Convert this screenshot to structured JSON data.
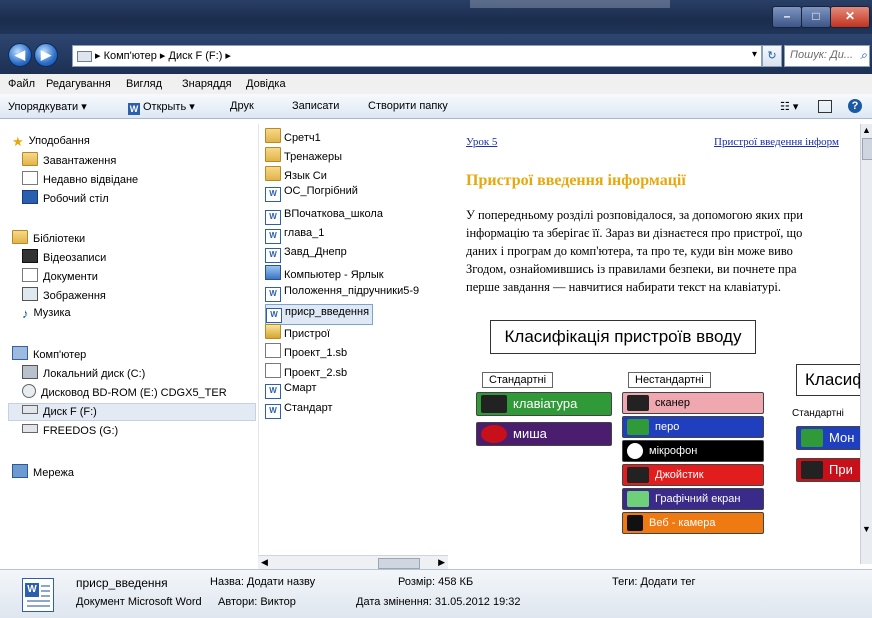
{
  "window": {
    "min_glyph": "–",
    "max_glyph": "□",
    "close_glyph": "✕"
  },
  "address": {
    "crumbs": "▸ Комп'ютер ▸ Диск F (F:) ▸",
    "search_placeholder": "Пошук: Ди..."
  },
  "menu": [
    "Файл",
    "Редагування",
    "Вигляд",
    "Знаряддя",
    "Довідка"
  ],
  "toolbar": {
    "organize": "Упорядкувати ▾",
    "open": "Открыть ▾",
    "print": "Друк",
    "burn": "Записати",
    "new_folder": "Створити папку"
  },
  "nav": {
    "favorites": "Уподобання",
    "downloads": "Завантаження",
    "recent": "Недавно відвідане",
    "desktop": "Робочий стіл",
    "libraries": "Бібліотеки",
    "videos": "Відеозаписи",
    "documents": "Документи",
    "pictures": "Зображення",
    "music": "Музика",
    "computer": "Комп'ютер",
    "local_c": "Локальний диск (C:)",
    "bd_rom": "Дисковод BD-ROM (E:) CDGX5_TER",
    "disk_f": "Диск F (F:)",
    "freedos": "FREEDOS (G:)",
    "network": "Мережа"
  },
  "files": [
    "Сретч1",
    "Тренажеры",
    "Язык Си",
    "ОС_Погрібний",
    "ВПочаткова_школа",
    "глава_1",
    "Завд_Днепр",
    "Компьютер - Ярлык",
    "Положення_підручники5-9",
    "присp_введення",
    "Пристрої",
    "Проект_1.sb",
    "Проект_2.sb",
    "Смарт",
    "Стандарт"
  ],
  "preview": {
    "lesson": "Урок 5",
    "top_link": "Пристрої введення інформ",
    "heading": "Пристрої введення інформації",
    "para": [
      "У попередньому розділі розповідалося, за допомогою яких при",
      "інформацію та зберігає її. Зараз ви дізнаєтеся про пристрої, що",
      "даних і програм до комп'ютера, та про те, куди він може виво",
      "Згодом, ознайомившись із правилами безпеки, ви почнете пра",
      "перше завдання — навчитися набирати текст на клавіатурі."
    ],
    "class_title": "Класифікація пристроїв вводу",
    "std_label": "Стандартні",
    "nonstd_label": "Нестандартні",
    "std_devices": [
      "клавіатура",
      "миша"
    ],
    "nonstd_devices": [
      "сканер",
      "перо",
      "мікрофон",
      "Джойстик",
      "Графічний екран",
      "Веб - камера"
    ],
    "right_title": "Класиф",
    "right_std": "Стандартні",
    "right_devices": [
      "Мон",
      "При"
    ]
  },
  "status": {
    "filename": "присp_введення",
    "filetype": "Документ Microsoft Word",
    "name_label": "Назва: Додати назву",
    "authors": "Автори: Виктор",
    "size": "Розмір: 458 КБ",
    "modified": "Дата змінення: 31.05.2012 19:32",
    "tags": "Теги: Додати тег"
  },
  "colors": {
    "keyboard": "#2f9a37",
    "mouse": "#4a1d6e",
    "scanner": "#f0a8b0",
    "pen": "#1f3fbf",
    "mic": "#000000",
    "joystick": "#e21d1d",
    "tablet": "#3a2a8a",
    "webcam": "#f07a12",
    "heading": "#e7a80d"
  }
}
